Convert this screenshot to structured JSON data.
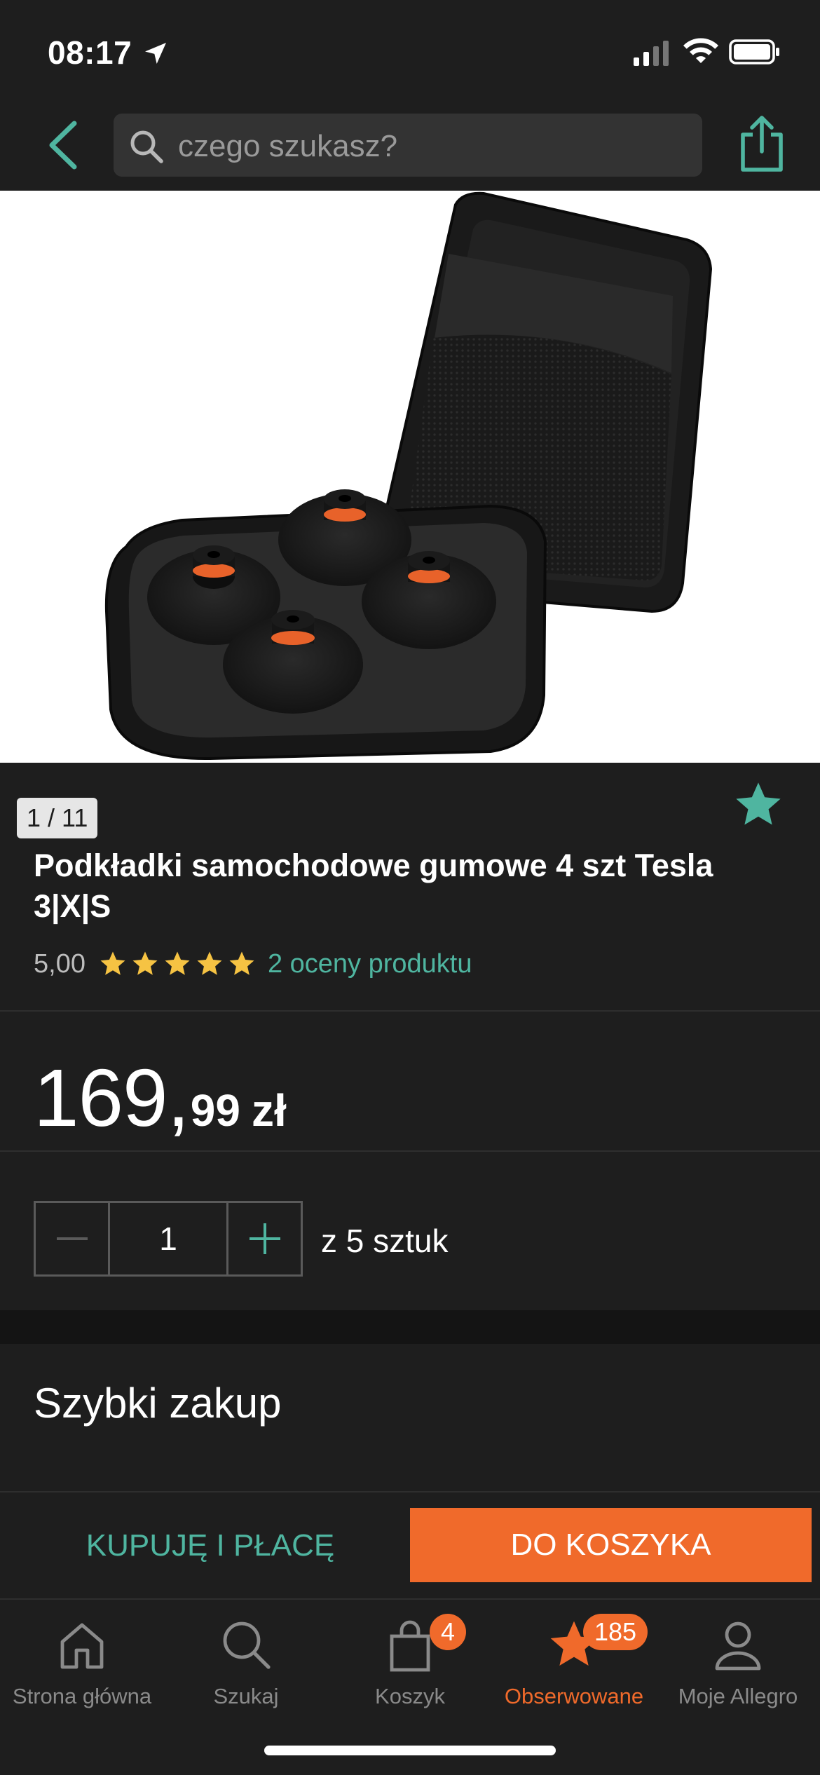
{
  "status_bar": {
    "time": "08:17"
  },
  "search": {
    "placeholder": "czego szukasz?"
  },
  "gallery": {
    "counter": "1 / 11"
  },
  "product": {
    "title": "Podkładki samochodowe gumowe 4 szt Tesla 3|X|S",
    "rating_value": "5,00",
    "rating_stars": 5,
    "rating_link": "2 oceny produktu"
  },
  "price": {
    "integer": "169,",
    "decimal": "99",
    "currency": "zł"
  },
  "quantity": {
    "value": "1",
    "label": "z 5 sztuk"
  },
  "quick_buy": {
    "title": "Szybki zakup"
  },
  "actions": {
    "buy_now": "KUPUJĘ I PŁACĘ",
    "add_to_cart": "DO KOSZYKA"
  },
  "tabbar": {
    "items": [
      {
        "label": "Strona główna",
        "icon": "home-icon"
      },
      {
        "label": "Szukaj",
        "icon": "search-icon"
      },
      {
        "label": "Koszyk",
        "icon": "bag-icon",
        "badge": "4"
      },
      {
        "label": "Obserwowane",
        "icon": "star-icon",
        "badge": "185",
        "active": true
      },
      {
        "label": "Moje Allegro",
        "icon": "person-icon"
      }
    ]
  },
  "colors": {
    "accent": "#4fb5a0",
    "brand": "#f06a2b",
    "background": "#1e1e1e",
    "star": "#f6c343"
  }
}
